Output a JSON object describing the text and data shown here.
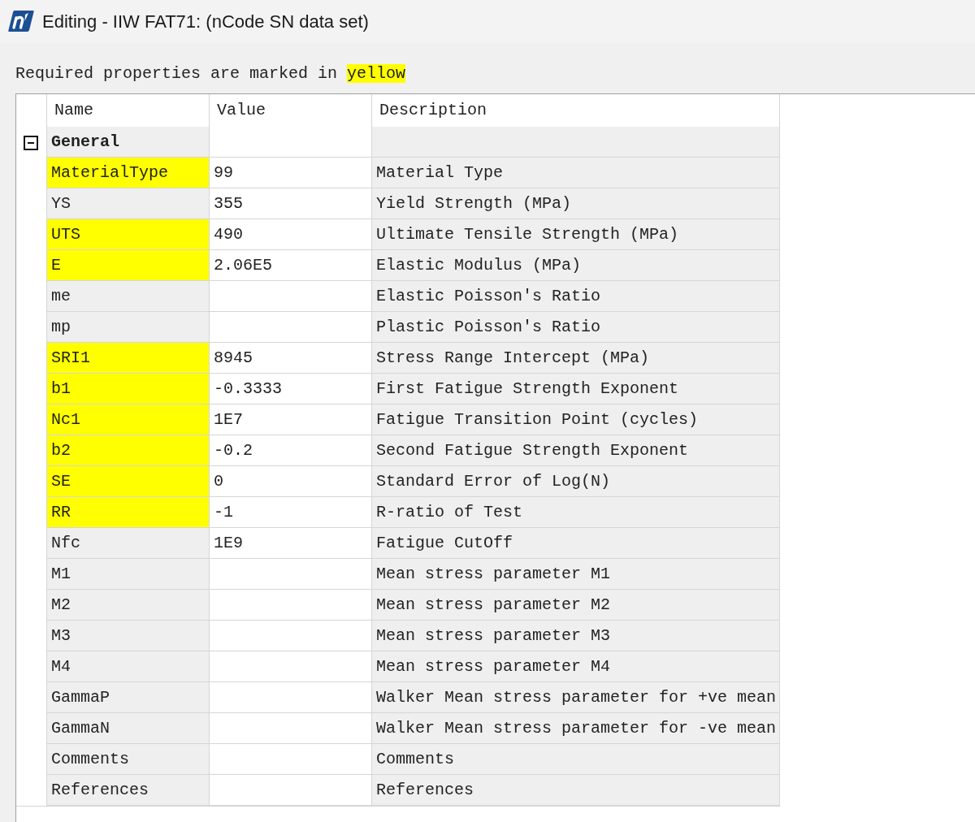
{
  "window": {
    "title": "Editing - IIW FAT71: (nCode SN data set)"
  },
  "legend": {
    "text": "Required properties are marked in",
    "highlight": "yellow"
  },
  "grid": {
    "columns": [
      "Name",
      "Value",
      "Description"
    ],
    "groups": [
      {
        "name": "General",
        "expanded": true,
        "properties": [
          {
            "name": "MaterialType",
            "value": "99",
            "description": "Material Type",
            "required": true
          },
          {
            "name": "YS",
            "value": "355",
            "description": "Yield Strength (MPa)",
            "required": false
          },
          {
            "name": "UTS",
            "value": "490",
            "description": "Ultimate Tensile Strength (MPa)",
            "required": true
          },
          {
            "name": "E",
            "value": "2.06E5",
            "description": "Elastic Modulus (MPa)",
            "required": true
          },
          {
            "name": "me",
            "description": "Elastic Poisson's Ratio",
            "required": false
          },
          {
            "name": "mp",
            "description": "Plastic Poisson's Ratio",
            "required": false
          },
          {
            "name": "SRI1",
            "value": "8945",
            "description": "Stress Range Intercept (MPa)",
            "required": true
          },
          {
            "name": "b1",
            "value": "-0.3333",
            "description": "First Fatigue Strength Exponent",
            "required": true
          },
          {
            "name": "Nc1",
            "value": "1E7",
            "description": "Fatigue Transition Point (cycles)",
            "required": true
          },
          {
            "name": "b2",
            "value": "-0.2",
            "description": "Second Fatigue Strength Exponent",
            "required": true
          },
          {
            "name": "SE",
            "value": "0",
            "description": "Standard Error of Log(N)",
            "required": true
          },
          {
            "name": "RR",
            "value": "-1",
            "description": "R-ratio of Test",
            "required": true
          },
          {
            "name": "Nfc",
            "value": "1E9",
            "description": "Fatigue CutOff",
            "required": false
          },
          {
            "name": "M1",
            "description": "Mean stress parameter M1",
            "required": false
          },
          {
            "name": "M2",
            "description": "Mean stress parameter M2",
            "required": false
          },
          {
            "name": "M3",
            "description": "Mean stress parameter M3",
            "required": false
          },
          {
            "name": "M4",
            "description": "Mean stress parameter M4",
            "required": false
          },
          {
            "name": "GammaP",
            "description": "Walker Mean stress parameter for +ve mean",
            "required": false
          },
          {
            "name": "GammaN",
            "description": "Walker Mean stress parameter for -ve mean",
            "required": false
          },
          {
            "name": "Comments",
            "description": "Comments",
            "required": false
          },
          {
            "name": "References",
            "description": "References",
            "required": false
          }
        ]
      }
    ]
  }
}
